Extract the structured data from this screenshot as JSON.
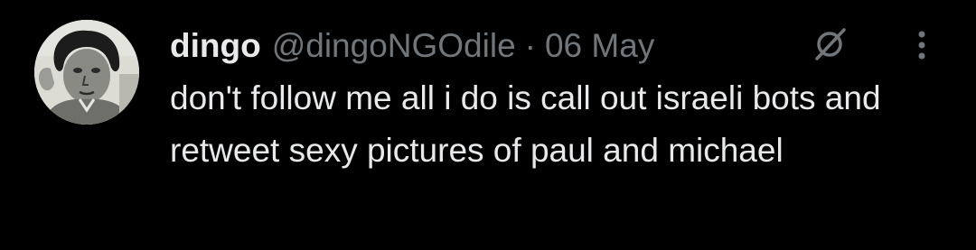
{
  "tweet": {
    "author": {
      "display_name": "dingo",
      "handle": "@dingoNGOdile"
    },
    "separator": "·",
    "date": "06 May",
    "text": "don't follow me all i do is call out israeli bots and retweet sexy pictures of paul and michael",
    "icons": {
      "grok": "grok-icon",
      "more": "more-options-icon",
      "avatar": "profile-photo"
    }
  },
  "colors": {
    "background": "#000000",
    "primary_text": "#e7e9ea",
    "secondary_text": "#71767b"
  }
}
